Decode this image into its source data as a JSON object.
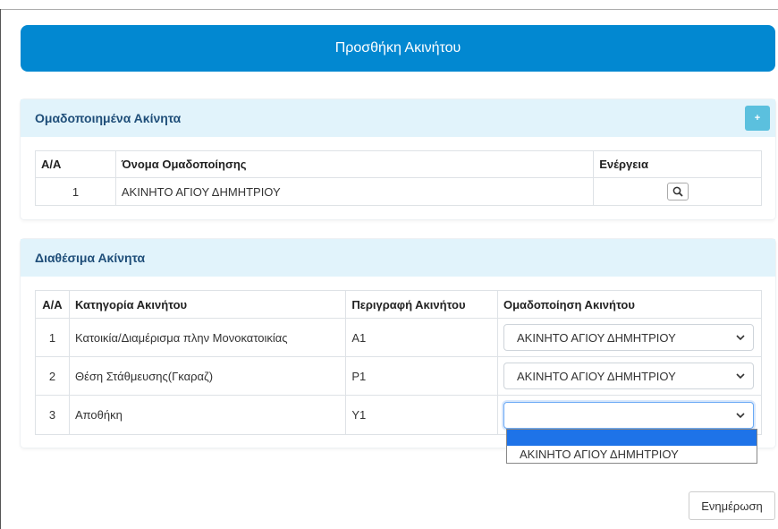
{
  "header": {
    "title": "Προσθήκη Ακινήτου"
  },
  "grouped": {
    "title": "Ομαδοποιημένα Ακίνητα",
    "add_label": "+",
    "columns": [
      "Α/Α",
      "Όνομα Ομαδοποίησης",
      "Ενέργεια"
    ],
    "rows": [
      {
        "no": "1",
        "name": "ΑΚΙΝΗΤΟ ΑΓΙΟΥ ΔΗΜΗΤΡΙΟΥ",
        "action_icon": "search-icon"
      }
    ]
  },
  "available": {
    "title": "Διαθέσιμα Ακίνητα",
    "columns": [
      "Α/Α",
      "Κατηγορία Ακινήτου",
      "Περιγραφή Ακινήτου",
      "Ομαδοποίηση Ακινήτου"
    ],
    "rows": [
      {
        "no": "1",
        "category": "Κατοικία/Διαμέρισμα πλην Μονοκατοικίας",
        "description": "A1",
        "group": "ΑΚΙΝΗΤΟ ΑΓΙΟΥ ΔΗΜΗΤΡΙΟΥ"
      },
      {
        "no": "2",
        "category": "Θέση Στάθμευσης(Γκαραζ)",
        "description": "P1",
        "group": "ΑΚΙΝΗΤΟ ΑΓΙΟΥ ΔΗΜΗΤΡΙΟΥ"
      },
      {
        "no": "3",
        "category": "Αποθήκη",
        "description": "Y1",
        "group": ""
      }
    ],
    "dropdown_options": [
      "",
      "ΑΚΙΝΗΤΟ ΑΓΙΟΥ ΔΗΜΗΤΡΙΟΥ"
    ]
  },
  "footer": {
    "update_label": "Ενημέρωση"
  },
  "colors": {
    "header_bg": "#0288d1",
    "panel_head_bg": "#e1f3fb",
    "panel_title": "#1f4e79",
    "accent_info": "#5bc0de",
    "selected_option": "#1e73e8"
  }
}
